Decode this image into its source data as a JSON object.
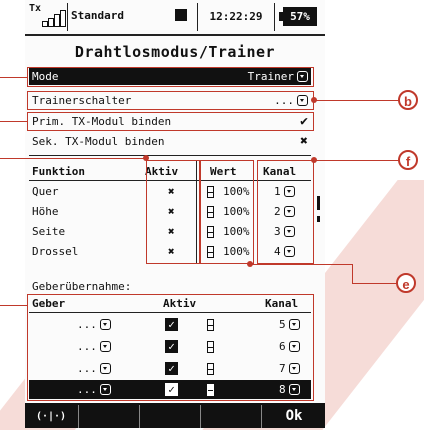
{
  "status_bar": {
    "tx": "Tx",
    "profile": "Standard",
    "time": "12:22:29",
    "battery": "57%"
  },
  "title": "Drahtlosmodus/Trainer",
  "mode": {
    "label": "Mode",
    "value": "Trainer"
  },
  "trainerschalter": {
    "label": "Trainerschalter",
    "value": "..."
  },
  "prim_tx": {
    "label": "Prim. TX-Modul binden",
    "mark": "✔"
  },
  "sek_tx": {
    "label": "Sek. TX-Modul binden",
    "mark": "✖"
  },
  "func_table": {
    "headers": {
      "funktion": "Funktion",
      "aktiv": "Aktiv",
      "wert": "Wert",
      "kanal": "Kanal"
    },
    "rows": [
      {
        "name": "Quer",
        "active": "✖",
        "value": "100%",
        "channel": "1"
      },
      {
        "name": "Höhe",
        "active": "✖",
        "value": "100%",
        "channel": "2"
      },
      {
        "name": "Seite",
        "active": "✖",
        "value": "100%",
        "channel": "3"
      },
      {
        "name": "Drossel",
        "active": "✖",
        "value": "100%",
        "channel": "4"
      }
    ]
  },
  "geber": {
    "section_title": "Geberübernahme:",
    "headers": {
      "geber": "Geber",
      "aktiv": "Aktiv",
      "kanal": "Kanal"
    },
    "rows": [
      {
        "geber": "...",
        "check": "✓",
        "channel": "5"
      },
      {
        "geber": "...",
        "check": "✓",
        "channel": "6"
      },
      {
        "geber": "...",
        "check": "✓",
        "channel": "7"
      },
      {
        "geber": "...",
        "check": "✓",
        "channel": "8"
      }
    ]
  },
  "footer": {
    "wireless_icon": "(·|·)",
    "ok_label": "Ok"
  },
  "annotations": {
    "b": "b",
    "f": "f",
    "e": "e"
  },
  "colors": {
    "annotation": "#c0392b",
    "watermark": "#f6dcd8",
    "display": "#111111"
  },
  "icons": [
    "signal-strength-icon",
    "record-icon",
    "battery-icon",
    "dropdown-icon",
    "checkmark-icon",
    "cross-icon",
    "checkbox-icon",
    "bar-gauge-icon",
    "wireless-icon",
    "scroll-indicator"
  ]
}
